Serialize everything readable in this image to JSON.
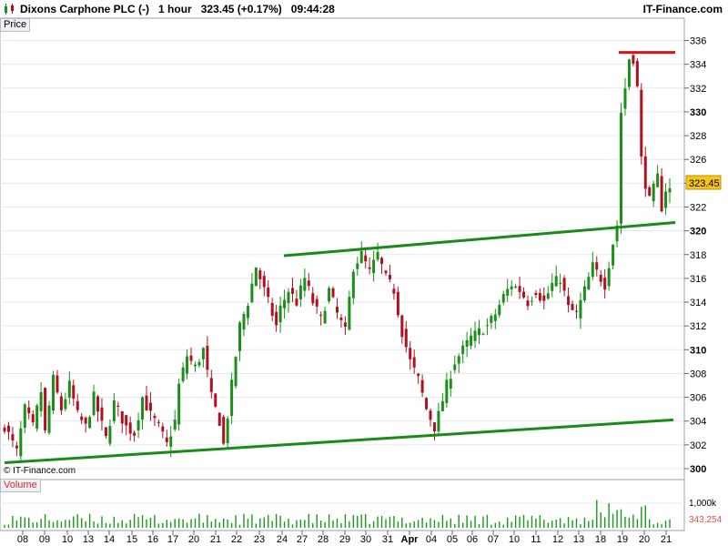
{
  "header": {
    "instrument": "Dixons Carphone PLC (-)",
    "interval": "1 hour",
    "price_change": "323.45 (+0.17%)",
    "time": "09:44:28",
    "brand": "IT-Finance.com"
  },
  "price_panel": {
    "label": "Price",
    "watermark": "© IT-Finance.com",
    "last_price": "323.45"
  },
  "volume_panel": {
    "label": "Volume",
    "scale_label": "1,000k",
    "last_volume": "343,254"
  },
  "colors": {
    "up_candle": "#1a8f1a",
    "down_candle": "#b01020",
    "trendline": "#1a8a1a",
    "resistance_line": "#e0101a",
    "price_tag": "#f5c518",
    "volume_bar": "#1a9a1a",
    "volume_tag": "#e05050"
  },
  "chart_data": {
    "type": "candlestick",
    "y_range": [
      300,
      336.5
    ],
    "y_ticks": [
      "300",
      "302",
      "304",
      "306",
      "308",
      "310",
      "312",
      "314",
      "316",
      "318",
      "320",
      "322",
      "324",
      "326",
      "328",
      "330",
      "332",
      "334",
      "336"
    ],
    "x_labels": [
      "08",
      "09",
      "10",
      "13",
      "14",
      "15",
      "16",
      "17",
      "20",
      "21",
      "22",
      "23",
      "24",
      "27",
      "28",
      "29",
      "30",
      "31",
      "Apr",
      "04",
      "05",
      "06",
      "07",
      "10",
      "11",
      "12",
      "13",
      "18",
      "19",
      "20",
      "21"
    ],
    "anchors": [
      [
        0,
        303.6
      ],
      [
        3,
        301.4
      ],
      [
        5,
        305.0
      ],
      [
        7,
        303.5
      ],
      [
        9,
        306.5
      ],
      [
        10,
        303.0
      ],
      [
        12,
        307.5
      ],
      [
        14,
        305.0
      ],
      [
        16,
        307.0
      ],
      [
        18,
        304.5
      ],
      [
        20,
        303.5
      ],
      [
        22,
        306.0
      ],
      [
        25,
        302.5
      ],
      [
        27,
        305.5
      ],
      [
        30,
        303.5
      ],
      [
        32,
        303.0
      ],
      [
        34,
        306.0
      ],
      [
        36,
        304.5
      ],
      [
        38,
        303.5
      ],
      [
        40,
        302.0
      ],
      [
        42,
        304.0
      ],
      [
        43,
        307.0
      ],
      [
        45,
        309.5
      ],
      [
        47,
        308.5
      ],
      [
        49,
        310.0
      ],
      [
        51,
        306.0
      ],
      [
        53,
        304.0
      ],
      [
        54,
        302.0
      ],
      [
        56,
        307.0
      ],
      [
        58,
        312.0
      ],
      [
        60,
        314.0
      ],
      [
        62,
        317.0
      ],
      [
        64,
        315.0
      ],
      [
        66,
        313.0
      ],
      [
        67,
        312.0
      ],
      [
        68,
        313.5
      ],
      [
        70,
        315.0
      ],
      [
        72,
        314.0
      ],
      [
        74,
        316.0
      ],
      [
        76,
        314.0
      ],
      [
        78,
        312.5
      ],
      [
        80,
        315.0
      ],
      [
        82,
        313.0
      ],
      [
        84,
        311.5
      ],
      [
        86,
        317.0
      ],
      [
        88,
        318.0
      ],
      [
        90,
        316.5
      ],
      [
        92,
        318.0
      ],
      [
        94,
        316.0
      ],
      [
        96,
        315.0
      ],
      [
        98,
        311.5
      ],
      [
        100,
        309.0
      ],
      [
        102,
        307.5
      ],
      [
        104,
        305.0
      ],
      [
        106,
        303.5
      ],
      [
        107,
        304.5
      ],
      [
        109,
        307.0
      ],
      [
        111,
        309.0
      ],
      [
        113,
        310.0
      ],
      [
        115,
        311.0
      ],
      [
        117,
        311.5
      ],
      [
        119,
        312.0
      ],
      [
        121,
        313.0
      ],
      [
        123,
        314.5
      ],
      [
        125,
        315.5
      ],
      [
        127,
        315.0
      ],
      [
        129,
        314.0
      ],
      [
        131,
        315.0
      ],
      [
        133,
        314.0
      ],
      [
        135,
        315.5
      ],
      [
        137,
        316.0
      ],
      [
        139,
        313.5
      ],
      [
        141,
        313.0
      ],
      [
        143,
        315.0
      ],
      [
        145,
        317.0
      ],
      [
        147,
        316.0
      ],
      [
        148,
        315.5
      ],
      [
        150,
        319.0
      ],
      [
        151,
        320.5
      ],
      [
        152,
        330.0
      ],
      [
        153,
        332.0
      ],
      [
        154,
        334.5
      ],
      [
        155,
        334.5
      ],
      [
        156,
        332.0
      ],
      [
        157,
        326.0
      ],
      [
        158,
        324.0
      ],
      [
        159,
        322.5
      ],
      [
        160,
        323.5
      ],
      [
        161,
        324.5
      ],
      [
        162,
        322.0
      ],
      [
        163,
        323.5
      ],
      [
        164,
        323.45
      ]
    ],
    "volume_last": 343254,
    "annotations": [
      {
        "type": "trendline",
        "from": [
          5,
          300.5
        ],
        "to": [
          740,
          304.1
        ]
      },
      {
        "type": "trendline",
        "from": [
          312,
          317.9
        ],
        "to": [
          742,
          320.7
        ]
      },
      {
        "type": "trendline",
        "from": [
          680,
          335.0
        ],
        "to": [
          742,
          335.0
        ]
      },
      {
        "type": "level",
        "value": 335.0
      }
    ]
  }
}
